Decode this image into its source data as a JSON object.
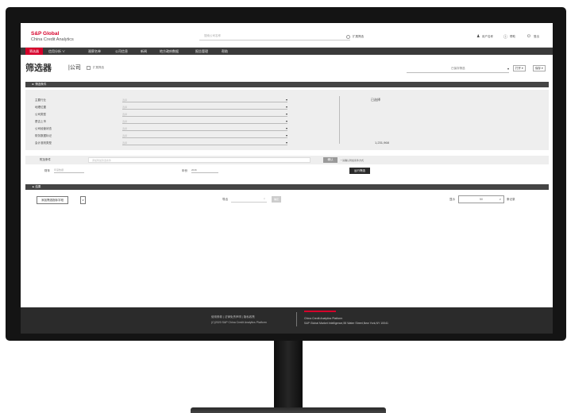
{
  "header": {
    "logo_main": "S&P Global",
    "logo_sub": "China Credit Analytics",
    "search_placeholder": "搜索公司名称",
    "expand_label": "扩展筛选",
    "user_label": "用户名称",
    "help_label": "帮助",
    "logout_label": "登出"
  },
  "nav": {
    "items": [
      "筛选器",
      "信用分析",
      "观察名单",
      "公司信息",
      "新闻",
      "地方政府数据",
      "报告管理",
      "帮助"
    ],
    "second_caret": "∨"
  },
  "title": {
    "main": "筛选器",
    "sub": "|公司",
    "expand_label": "扩展筛选",
    "saved_select_placeholder": "已保存筛选",
    "open_label": "打开",
    "save_label": "保存",
    "caret": "▾"
  },
  "criteria": {
    "section_label": "► 筛选条件",
    "rows": [
      {
        "label": "主要行业",
        "value": "选择"
      },
      {
        "label": "地理位置",
        "value": "选择"
      },
      {
        "label": "公司类型",
        "value": "选择"
      },
      {
        "label": "是否上市",
        "value": "选择"
      },
      {
        "label": "公司经营状态",
        "value": "选择"
      },
      {
        "label": "财务数据标记",
        "value": "选择"
      },
      {
        "label": "会计准则类型",
        "value": "选择"
      }
    ],
    "caret": "▾",
    "selected_label": "已选择",
    "count": "1,231,968",
    "other_label": "附加条件",
    "other_placeholder": "添加附加筛选条件",
    "confirm_label": "确认",
    "note": "* 请确认附加条件方式",
    "period_label": "财年",
    "period_value": "年度数据",
    "year_label": "年份",
    "year_value": "2016",
    "run_label": "运行筛选"
  },
  "results": {
    "section_label": "▲ 结果",
    "button_label": "添加筛选指标字段",
    "button2_label": "∨",
    "export_label": "导出",
    "export_caret": "∨",
    "export_btn": "确定",
    "show_label": "显示",
    "show_value": "50",
    "records_label": "条记录"
  },
  "footer": {
    "links": "使用条款  |  法律免责声明  |  隐私政策",
    "copyright": "(C)2020 S&P China Credit Analytics Platform",
    "platform": "China Credit Analytics Platform",
    "address": "S&P Global Market Intelligence,55 Water Street,New York,NY 10041"
  },
  "colors": {
    "brand_red": "#d6002a",
    "nav_bg": "#3a3a3a",
    "section_bar": "#444444",
    "footer_bg": "#2b2b2b"
  }
}
